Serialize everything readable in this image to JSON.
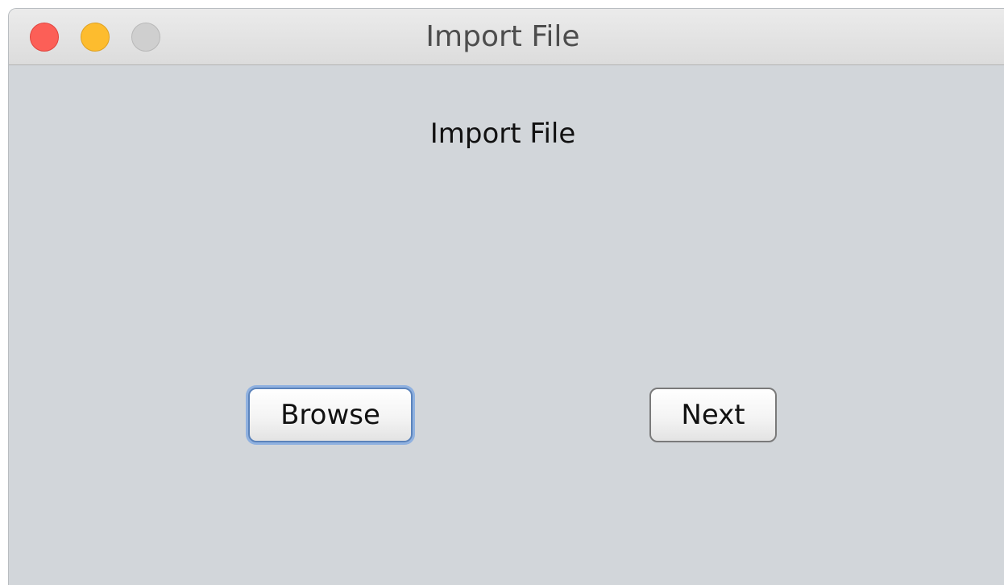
{
  "window": {
    "title": "Import File",
    "controls": {
      "close": "close-icon",
      "minimize": "minimize-icon",
      "zoom": "zoom-icon"
    }
  },
  "content": {
    "heading": "Import File",
    "buttons": {
      "browse_label": "Browse",
      "next_label": "Next"
    }
  },
  "colors": {
    "background": "#d2d6da",
    "close": "#fc5f57",
    "minimize": "#fdbc2e",
    "zoom_disabled": "#cfcfcf",
    "focus_ring": "#8fb1e0"
  }
}
